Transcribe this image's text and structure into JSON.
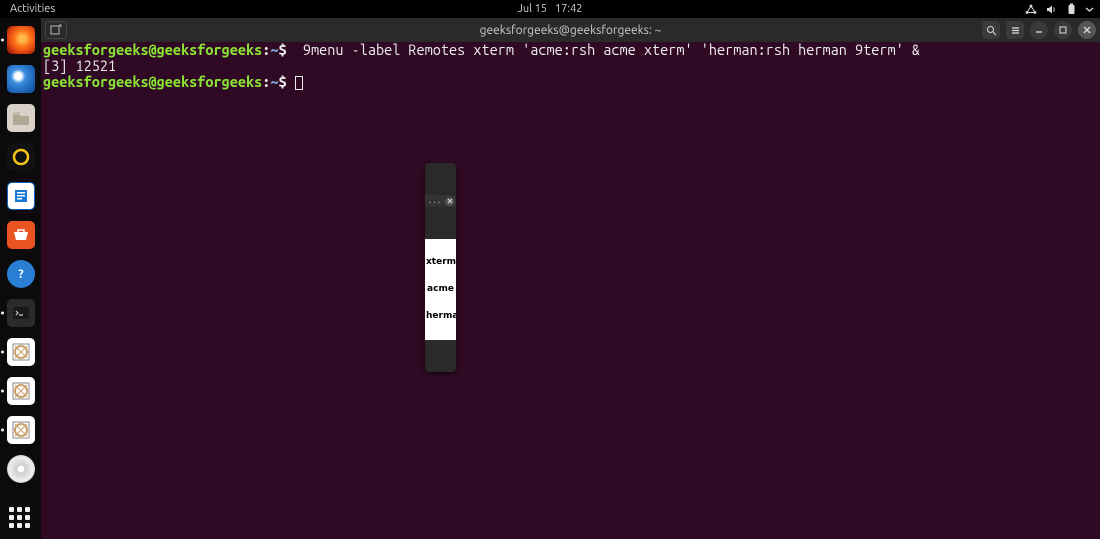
{
  "topbar": {
    "activities": "Activities",
    "date": "Jul 15",
    "time": "17:42"
  },
  "dock": {
    "items": [
      {
        "name": "firefox",
        "running": true
      },
      {
        "name": "thunderbird",
        "running": false
      },
      {
        "name": "files",
        "running": false
      },
      {
        "name": "rhythmbox",
        "running": false
      },
      {
        "name": "libreoffice-writer",
        "running": false
      },
      {
        "name": "software",
        "running": false
      },
      {
        "name": "help",
        "running": false
      },
      {
        "name": "terminal",
        "running": true
      },
      {
        "name": "xterm-1",
        "running": true
      },
      {
        "name": "xterm-2",
        "running": true
      },
      {
        "name": "xterm-3",
        "running": true
      },
      {
        "name": "disc",
        "running": false
      }
    ]
  },
  "terminal": {
    "title": "geeksforgeeks@geeksforgeeks: ~",
    "prompt_user": "geeksforgeeks@geeksforgeeks",
    "prompt_sep": ":",
    "prompt_path": "~",
    "prompt_symbol": "$",
    "cmd1": " 9menu -label Remotes xterm 'acme:rsh acme xterm' 'herman:rsh herman 9term' &",
    "out1": "[3] 12521"
  },
  "popup": {
    "title": "...",
    "items": [
      "xterm",
      "acme",
      "herman"
    ]
  }
}
